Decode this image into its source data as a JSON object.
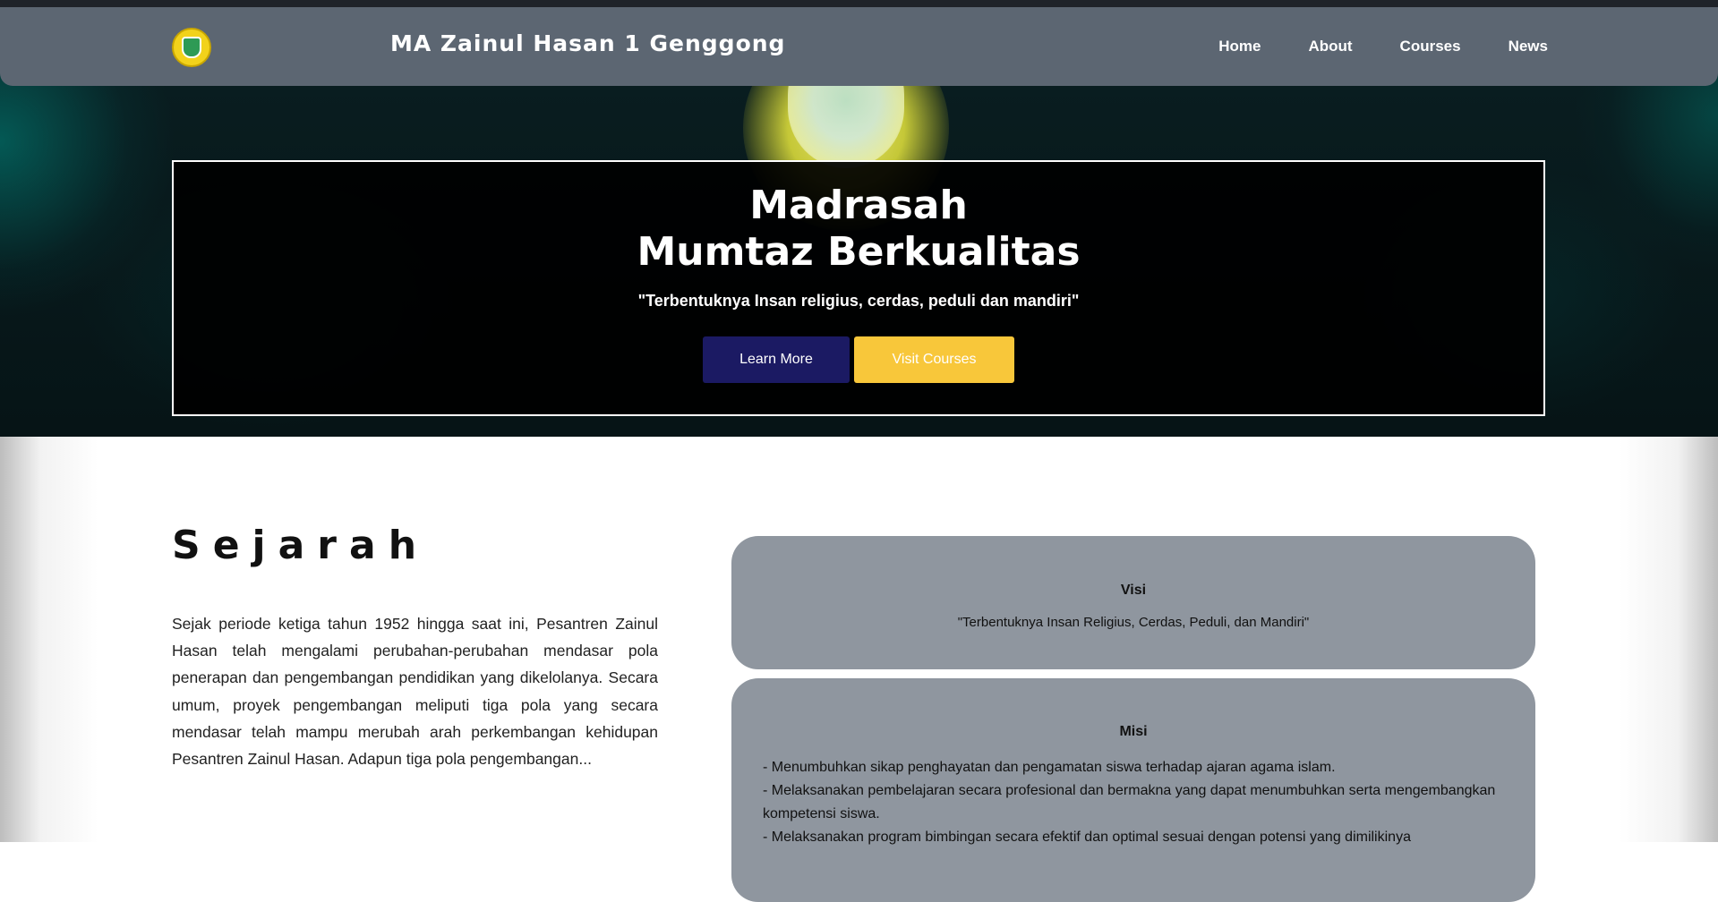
{
  "navbar": {
    "brand": "MA Zainul Hasan 1 Genggong",
    "links": [
      "Home",
      "About",
      "Courses",
      "News"
    ]
  },
  "hero": {
    "title_line1": "Madrasah",
    "title_line2": "Mumtaz Berkualitas",
    "subtitle": "\"Terbentuknya Insan religius, cerdas, peduli dan mandiri\"",
    "learn_more": "Learn More",
    "visit_courses": "Visit Courses"
  },
  "sejarah": {
    "title": "Sejarah",
    "text": "Sejak periode ketiga tahun 1952 hingga saat ini, Pesantren Zainul Hasan telah mengalami perubahan-perubahan mendasar pola penerapan dan pengembangan pendidikan yang dikelolanya. Secara umum, proyek pengembangan meliputi tiga pola yang secara mendasar telah mampu merubah arah perkembangan kehidupan Pesantren Zainul Hasan. Adapun tiga pola pengembangan..."
  },
  "visi": {
    "heading": "Visi",
    "text": "\"Terbentuknya Insan Religius, Cerdas, Peduli, dan Mandiri\""
  },
  "misi": {
    "heading": "Misi",
    "items": [
      "- Menumbuhkan sikap penghayatan dan pengamatan siswa terhadap ajaran agama islam.",
      "- Melaksanakan pembelajaran secara profesional dan bermakna yang dapat menumbuhkan serta mengembangkan kompetensi siswa.",
      "- Melaksanakan program bimbingan secara efektif dan optimal sesuai dengan potensi yang dimilikinya"
    ]
  },
  "colors": {
    "navbar_bg": "#5c6672",
    "learn_more_bg": "#1b1a63",
    "visit_courses_bg": "#f8c73a",
    "card_bg": "#8f969f"
  }
}
